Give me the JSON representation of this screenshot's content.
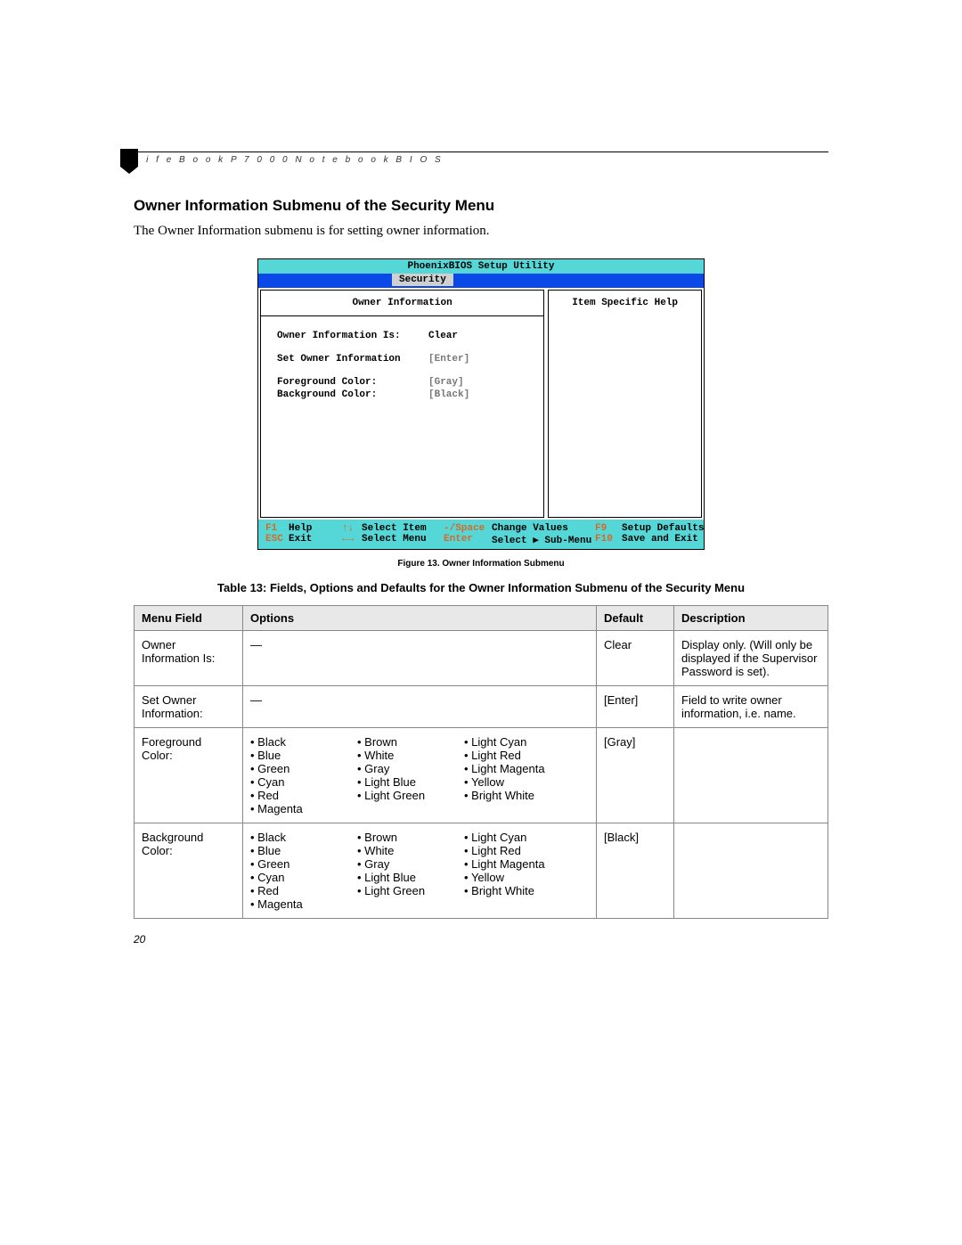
{
  "header": "L i f e B o o k   P 7 0 0 0   N o t e b o o k   B I O S",
  "section_title": "Owner Information Submenu of the Security Menu",
  "body_text": "The Owner Information submenu is for setting owner information.",
  "bios": {
    "utility_title": "PhoenixBIOS Setup Utility",
    "tab": "Security",
    "left_title": "Owner Information",
    "right_title": "Item Specific Help",
    "rows": {
      "r1_label": "Owner Information Is:",
      "r1_value": "Clear",
      "r2_label": "Set Owner Information",
      "r2_value": "[Enter]",
      "r3_label": "Foreground Color:",
      "r3_value": "[Gray]",
      "r4_label": "Background Color:",
      "r4_value": "[Black]"
    },
    "footer": {
      "f1": "F1",
      "help": "Help",
      "ud": "↑↓",
      "sel_item": "Select Item",
      "ms": "-/Space",
      "chg": "Change Values",
      "f9": "F9",
      "defaults": "Setup Defaults",
      "esc": "ESC",
      "exit": "Exit",
      "lr": "←→",
      "sel_menu": "Select Menu",
      "enter": "Enter",
      "sub": "Select ▶ Sub-Menu",
      "f10": "F10",
      "save": "Save and Exit"
    }
  },
  "figure_caption": "Figure 13.   Owner Information Submenu",
  "table_title": "Table 13: Fields, Options and Defaults for the Owner Information Submenu of the Security Menu",
  "table_headers": {
    "h1": "Menu Field",
    "h2": "Options",
    "h3": "Default",
    "h4": "Description"
  },
  "rows": {
    "r1": {
      "field": "Owner Information Is:",
      "options": "—",
      "default": "Clear",
      "desc": "Display only. (Will only be displayed if the Supervisor Password is set)."
    },
    "r2": {
      "field": "Set Owner Information:",
      "options": "—",
      "default": "[Enter]",
      "desc": "Field to write owner information, i.e. name."
    },
    "r3": {
      "field": "Foreground Color:",
      "default": "[Gray]",
      "desc": "",
      "col1": [
        "Black",
        "Blue",
        "Green",
        "Cyan",
        "Red",
        "Magenta"
      ],
      "col2": [
        "Brown",
        "White",
        "Gray",
        "Light Blue",
        "Light Green"
      ],
      "col3": [
        "Light Cyan",
        "Light Red",
        "Light Magenta",
        "Yellow",
        "Bright White"
      ]
    },
    "r4": {
      "field": "Background Color:",
      "default": "[Black]",
      "desc": "",
      "col1": [
        "Black",
        "Blue",
        "Green",
        "Cyan",
        "Red",
        "Magenta"
      ],
      "col2": [
        "Brown",
        "White",
        "Gray",
        "Light Blue",
        "Light Green"
      ],
      "col3": [
        "Light Cyan",
        "Light Red",
        "Light Magenta",
        "Yellow",
        "Bright White"
      ]
    }
  },
  "page_number": "20"
}
